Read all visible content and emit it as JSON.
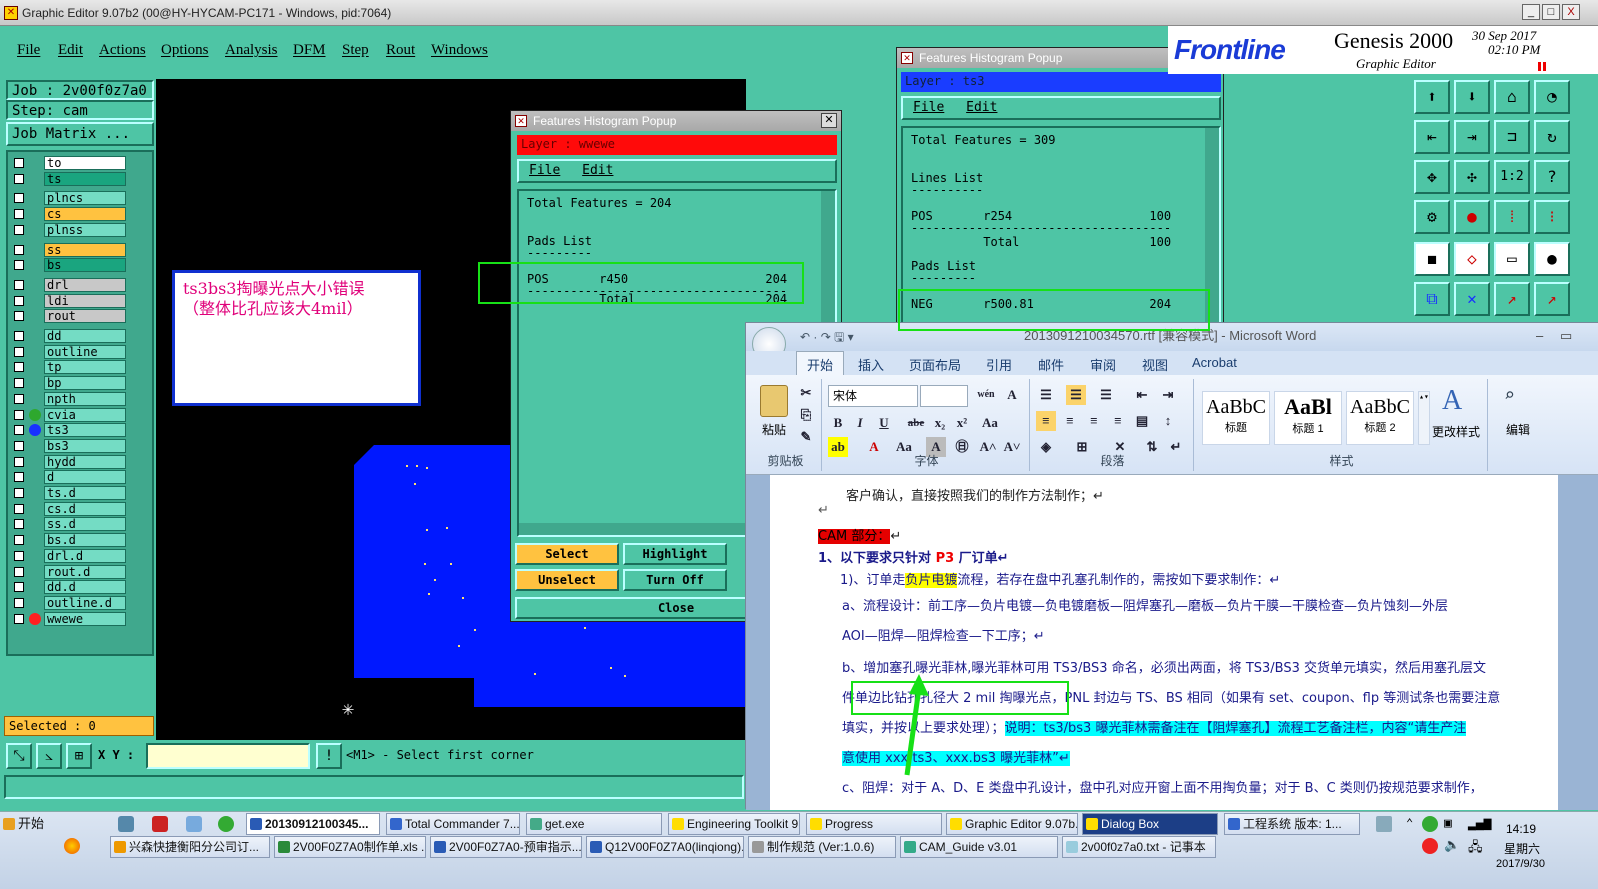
{
  "window": {
    "title": "Graphic Editor 9.07b2 (00@HY-HYCAM-PC171 - Windows, pid:7064)",
    "min": "_",
    "max": "□",
    "close": "X"
  },
  "menu": [
    "File",
    "Edit",
    "Actions",
    "Options",
    "Analysis",
    "DFM",
    "Step",
    "Rout",
    "Windows"
  ],
  "left": {
    "job": "Job : 2v00f0z7a0",
    "step": "Step: cam",
    "job_matrix": "Job Matrix ...",
    "layers": [
      {
        "name": "to",
        "color": "#ffffff",
        "dot": ""
      },
      {
        "name": "ts",
        "color": "#1aa57f",
        "dot": ""
      },
      {
        "name": "plncs",
        "color": "#74dcc4",
        "dot": ""
      },
      {
        "name": "cs",
        "color": "#ffc240",
        "dot": ""
      },
      {
        "name": "plnss",
        "color": "#74dcc4",
        "dot": ""
      },
      {
        "name": "ss",
        "color": "#ffc240",
        "dot": ""
      },
      {
        "name": "bs",
        "color": "#1aa57f",
        "dot": ""
      },
      {
        "name": "drl",
        "color": "#c8c8c8",
        "dot": ""
      },
      {
        "name": "ldi",
        "color": "#c8c8c8",
        "dot": ""
      },
      {
        "name": "rout",
        "color": "#c8c8c8",
        "dot": ""
      },
      {
        "name": "dd",
        "color": "#74dcc4",
        "dot": ""
      },
      {
        "name": "outline",
        "color": "#74dcc4",
        "dot": ""
      },
      {
        "name": "tp",
        "color": "#74dcc4",
        "dot": ""
      },
      {
        "name": "bp",
        "color": "#74dcc4",
        "dot": ""
      },
      {
        "name": "npth",
        "color": "#74dcc4",
        "dot": ""
      },
      {
        "name": "cvia",
        "color": "#74dcc4",
        "dot": "#2ea82e"
      },
      {
        "name": "ts3",
        "color": "#74dcc4",
        "dot": "#1830ff"
      },
      {
        "name": "bs3",
        "color": "#74dcc4",
        "dot": ""
      },
      {
        "name": "hydd",
        "color": "#74dcc4",
        "dot": ""
      },
      {
        "name": "d",
        "color": "#74dcc4",
        "dot": ""
      },
      {
        "name": "ts.d",
        "color": "#74dcc4",
        "dot": ""
      },
      {
        "name": "cs.d",
        "color": "#74dcc4",
        "dot": ""
      },
      {
        "name": "ss.d",
        "color": "#74dcc4",
        "dot": ""
      },
      {
        "name": "bs.d",
        "color": "#74dcc4",
        "dot": ""
      },
      {
        "name": "drl.d",
        "color": "#74dcc4",
        "dot": ""
      },
      {
        "name": "rout.d",
        "color": "#74dcc4",
        "dot": ""
      },
      {
        "name": "dd.d",
        "color": "#74dcc4",
        "dot": ""
      },
      {
        "name": "outline.d",
        "color": "#74dcc4",
        "dot": ""
      },
      {
        "name": "wwewe",
        "color": "#74dcc4",
        "dot": "#ff2020"
      }
    ],
    "selected": "Selected : 0"
  },
  "note": {
    "line1": "ts3bs3掏曝光点大小错误",
    "line2": "（整体比孔应该大4mil）"
  },
  "cmd": {
    "xy_label": "X Y :",
    "prompt": "<M1> - Select first corner",
    "xy_value": ""
  },
  "popup1": {
    "title": "Features Histogram Popup",
    "layer": "Layer :  wwewe",
    "menu": [
      "File",
      "Edit"
    ],
    "total": "Total Features = 204",
    "pads_head": "Pads List",
    "underline": "---------",
    "row": "POS       r450                   204",
    "dashes": "------------------------------------",
    "total_row": "          Total                  204",
    "buttons": {
      "select": "Select",
      "highlight": "Highlight",
      "unselect": "Unselect",
      "turnoff": "Turn Off",
      "close": "Close"
    }
  },
  "popup2": {
    "title": "Features Histogram Popup",
    "layer": "Layer :  ts3",
    "menu": [
      "File",
      "Edit"
    ],
    "total": "Total Features = 309",
    "lines_head": "Lines List",
    "underline": "----------",
    "pos_row": "POS       r254                   100",
    "dashes": "------------------------------------",
    "pos_total": "          Total                  100",
    "pads_head": "Pads List",
    "pads_underline": "---------",
    "neg_row": "NEG       r500.81                204"
  },
  "genesis": {
    "brand": "Frontline",
    "product": "Genesis 2000",
    "sub": "Graphic Editor",
    "date": "30 Sep 2017",
    "time": "02:10 PM"
  },
  "word": {
    "title": "20130912100345​70.rtf [兼容模式] - Microsoft Word",
    "tabs": [
      "开始",
      "插入",
      "页面布局",
      "引用",
      "邮件",
      "审阅",
      "视图",
      "Acrobat"
    ],
    "groups": {
      "clipboard": "剪贴板",
      "paste": "粘贴",
      "font": "字体",
      "paragraph": "段落",
      "styles": "样式",
      "change_styles": "更改样式",
      "edit": "编辑"
    },
    "font_name": "宋体",
    "styles": [
      {
        "sample": "AaBbC",
        "label": "标题"
      },
      {
        "sample": "AaBl",
        "label": "标题 1"
      },
      {
        "sample": "AaBbC",
        "label": "标题 2"
      }
    ],
    "lines": {
      "l0": "客户确认，直接按照我们的制作方法制作；↵",
      "l1": "↵",
      "cam": "CAM 部分：",
      "cam_after": "↵",
      "l2a": "1、以下要求只针对 ",
      "l2b": "P3",
      "l2c": " 厂订单↵",
      "l3a": "1)、订单走",
      "l3b": "负片电镀",
      "l3c": "流程，若存在盘中孔塞孔制作的，需按如下要求制作：↵",
      "l4": "a、流程设计：前工序—负片电镀—负电镀磨板—阻焊塞孔—磨板—负片干膜—干膜检查—负片蚀刻—外层",
      "l5": "AOI—阻焊—阻焊检查—下工序；↵",
      "l6": "b、增加塞孔曝光菲林,曝光菲林可用 TS3/BS3 命名，必须出两面，将 TS3/BS3 交货单元填实，然后用塞孔层文",
      "l7": "件单边比钻孔孔径大 2 mil 掏曝光点，PNL 封边与 TS、BS 相同（如果有 set、coupon、flp 等测试条也需要注意",
      "l8a": "填实，并按以上要求处理）；",
      "l8b": "说明：ts3/bs3 曝光菲林需备注在【阻焊塞孔】流程工艺备注栏，内容“请生产注",
      "l9": "意使用 xxx.ts3、xxx.bs3 曝光菲林”↵",
      "l10": "c、阻焊：对于 A、D、E 类盘中孔设计，盘中孔对应开窗上面不用掏负量；对于 B、C 类则仍按规范要求制作，"
    }
  },
  "taskbar": {
    "start": "开始",
    "row1": [
      "20130912100345...",
      "Total Commander 7....",
      "get.exe",
      "Engineering Toolkit 9...",
      "Progress",
      "Graphic Editor 9.07b...",
      "Dialog Box",
      "工程系统  版本: 1..."
    ],
    "row2": [
      "兴森快捷衡阳分公司订...",
      "2V00F0Z7A0制作单.xls ...",
      "2V00F0Z7A0-预审指示....",
      "Q12V00F0Z7A0(linqiong)...",
      "制作规范 (Ver:1.0.6)",
      "CAM_Guide v3.01",
      "2v00f0z7a0.txt - 记事本"
    ],
    "clock": "14:19",
    "weekday": "星期六",
    "date": "2017/9/30"
  }
}
